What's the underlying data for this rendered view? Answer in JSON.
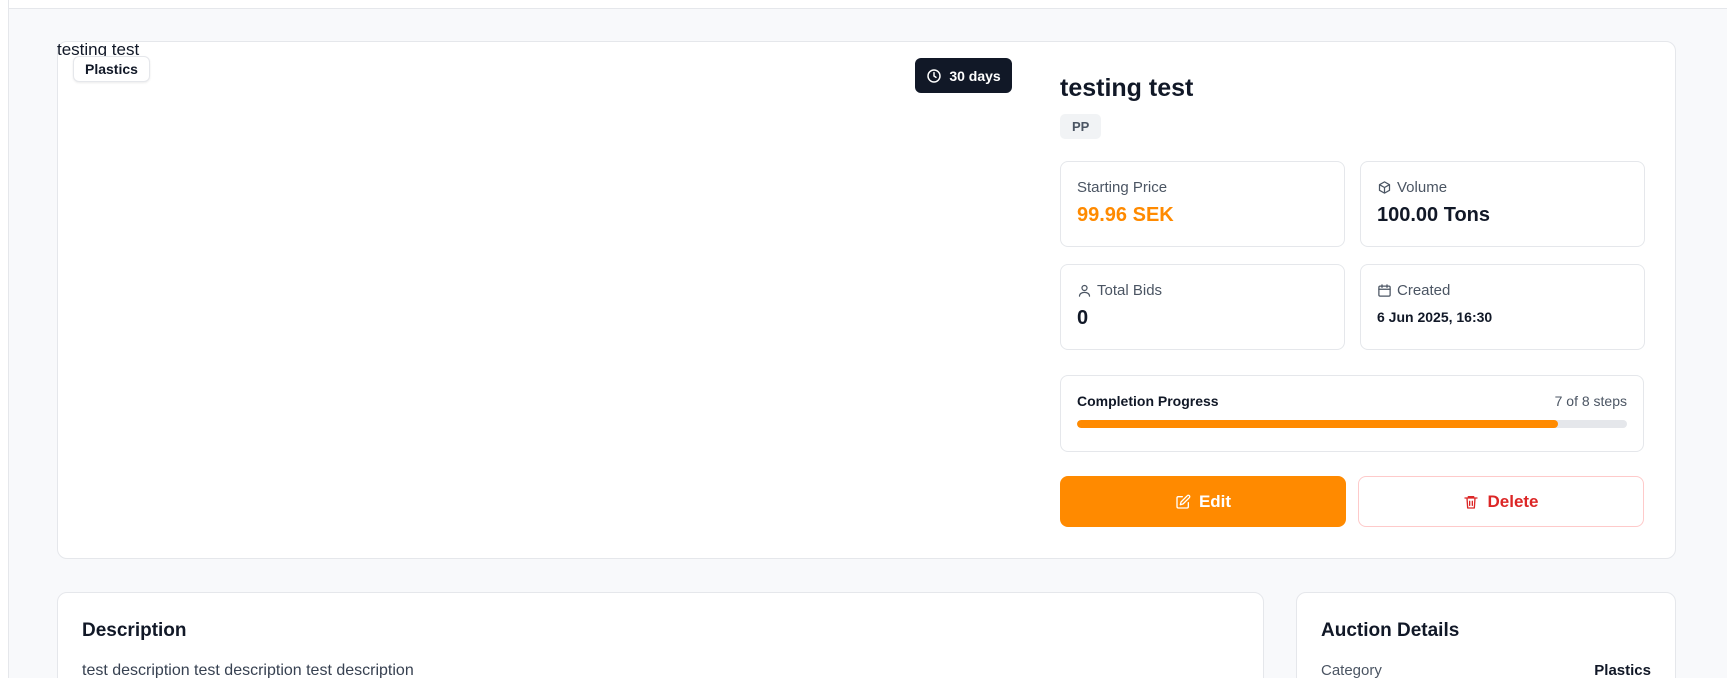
{
  "listing": {
    "image_alt": "testing test",
    "category_badge": "Plastics",
    "time_left": "30 days",
    "title": "testing test",
    "material_tag": "PP"
  },
  "stats": {
    "starting_price_label": "Starting Price",
    "starting_price_value": "99.96 SEK",
    "volume_label": "Volume",
    "volume_value": "100.00 Tons",
    "total_bids_label": "Total Bids",
    "total_bids_value": "0",
    "created_label": "Created",
    "created_value": "6 Jun 2025, 16:30"
  },
  "progress": {
    "label": "Completion Progress",
    "count_text": "7 of 8 steps",
    "completed_steps": 7,
    "total_steps": 8
  },
  "actions": {
    "edit_label": "Edit",
    "delete_label": "Delete"
  },
  "description": {
    "title": "Description",
    "text": "test description test description test description"
  },
  "auction_details": {
    "title": "Auction Details",
    "category_label": "Category",
    "category_value": "Plastics"
  },
  "colors": {
    "accent": "#ff8a00",
    "danger": "#dc2626",
    "dark_badge": "#111827"
  },
  "icons": {
    "clock": "clock-icon",
    "volume": "box-icon",
    "bids": "user-icon",
    "created": "calendar-icon",
    "edit": "edit-icon",
    "delete": "trash-icon"
  }
}
